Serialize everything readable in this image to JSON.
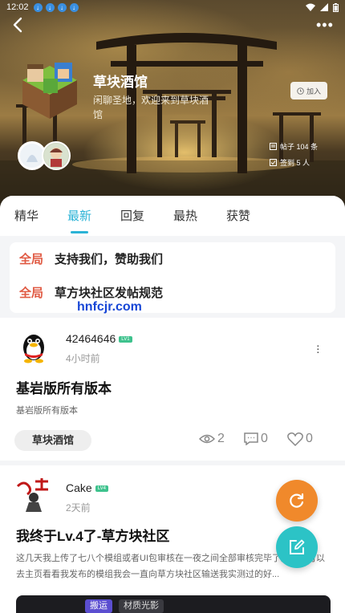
{
  "status_bar": {
    "time": "12:02"
  },
  "group": {
    "name": "草块酒馆",
    "description": "闲聊圣地，欢迎来到草块酒馆",
    "join_label": "加入",
    "posts_stat": "帖子 104 条",
    "checkin_stat": "签到 5 人"
  },
  "tabs": [
    {
      "label": "精华"
    },
    {
      "label": "最新"
    },
    {
      "label": "回复"
    },
    {
      "label": "最热"
    },
    {
      "label": "获赞"
    }
  ],
  "pinned": [
    {
      "tag": "全局",
      "title": "支持我们，赞助我们"
    },
    {
      "tag": "全局",
      "title": "草方块社区发帖规范"
    }
  ],
  "watermark": "hnfcjr.com",
  "posts": [
    {
      "author": "42464646",
      "level": "LV1",
      "time": "4小时前",
      "title": "基岩版所有版本",
      "excerpt": "基岩版所有版本",
      "group_chip": "草块酒馆",
      "views": "2",
      "comments": "0",
      "likes": "0"
    },
    {
      "author": "Cake",
      "level": "LV4",
      "time": "2天前",
      "title": "我终于Lv.4了-草方块社区",
      "excerpt": "这几天我上传了七八个模组或者UI包审核在一夜之间全部审核完毕了大家都可以去主页看看我发布的模组我会一直向草方块社区输送我实测过的好...",
      "tags": [
        "搬运",
        "材质光影"
      ]
    }
  ],
  "colors": {
    "accent": "#2bb3d6",
    "pinned_tag": "#e05a43",
    "fab_refresh": "#f0892b",
    "fab_compose": "#2cc3c6",
    "level_badge": "#3ec28d"
  },
  "icons": [
    "back-arrow-icon",
    "more-dots-icon",
    "join-icon",
    "posts-icon",
    "checkin-icon",
    "eye-icon",
    "comment-icon",
    "heart-icon",
    "refresh-icon",
    "compose-icon"
  ]
}
